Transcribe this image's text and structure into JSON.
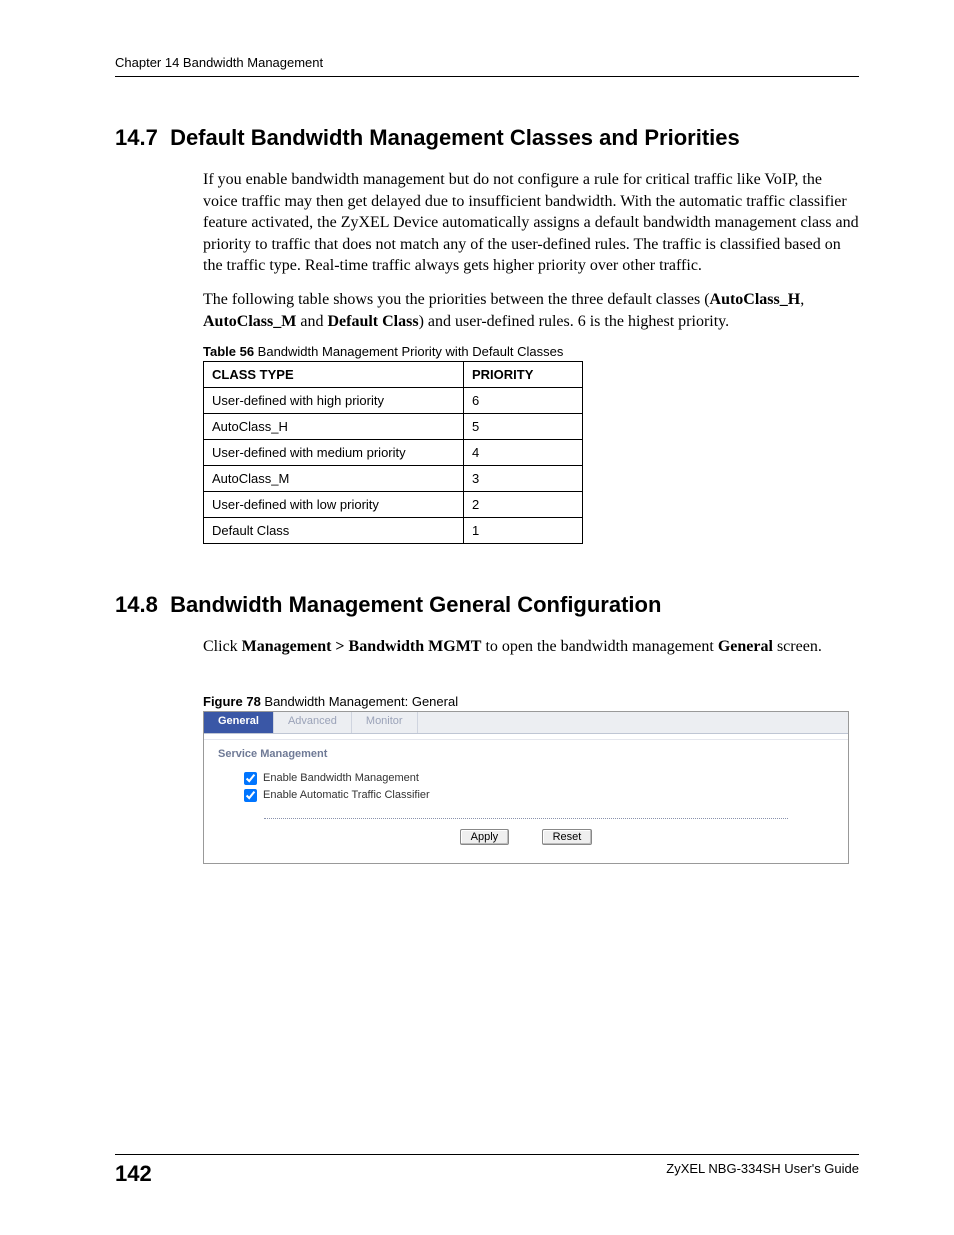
{
  "header": {
    "chapter_line": "Chapter 14 Bandwidth Management"
  },
  "section1": {
    "number": "14.7",
    "title": "Default Bandwidth Management Classes and Priorities",
    "para1": "If you enable bandwidth management but do not configure a rule for critical traffic like VoIP, the voice traffic may then get delayed due to insufficient bandwidth. With the automatic traffic classifier feature activated, the ZyXEL Device automatically assigns a default bandwidth management class and priority to traffic that does not match any of the user-defined rules. The traffic is classified based on the traffic type. Real-time traffic always gets higher priority over other traffic.",
    "para2_pre": "The following table shows you the priorities between the three default classes (",
    "para2_b1": "AutoClass_H",
    "para2_mid1": ", ",
    "para2_b2": "AutoClass_M",
    "para2_mid2": " and ",
    "para2_b3": "Default Class",
    "para2_post": ") and user-defined rules. 6 is the highest priority."
  },
  "table56": {
    "caption_bold": "Table 56",
    "caption_rest": "   Bandwidth Management Priority with Default Classes",
    "head_class": "CLASS TYPE",
    "head_priority": "PRIORITY",
    "rows": [
      {
        "c": "User-defined with high priority",
        "p": "6"
      },
      {
        "c": "AutoClass_H",
        "p": "5"
      },
      {
        "c": "User-defined with medium priority",
        "p": "4"
      },
      {
        "c": "AutoClass_M",
        "p": "3"
      },
      {
        "c": "User-defined with low priority",
        "p": "2"
      },
      {
        "c": "Default Class",
        "p": "1"
      }
    ]
  },
  "section2": {
    "number": "14.8",
    "title": "Bandwidth Management General Configuration",
    "para_pre": "Click ",
    "para_b1": "Management > Bandwidth MGMT",
    "para_mid": " to open the bandwidth management ",
    "para_b2": "General",
    "para_post": " screen."
  },
  "figure78": {
    "caption_bold": "Figure 78",
    "caption_rest": "   Bandwidth Management: General",
    "tabs": {
      "general": "General",
      "advanced": "Advanced",
      "monitor": "Monitor"
    },
    "section_label": "Service Management",
    "cb1_label": "Enable Bandwidth Management",
    "cb2_label": "Enable Automatic Traffic Classifier",
    "apply": "Apply",
    "reset": "Reset"
  },
  "footer": {
    "page": "142",
    "guide": "ZyXEL NBG-334SH User's Guide"
  }
}
